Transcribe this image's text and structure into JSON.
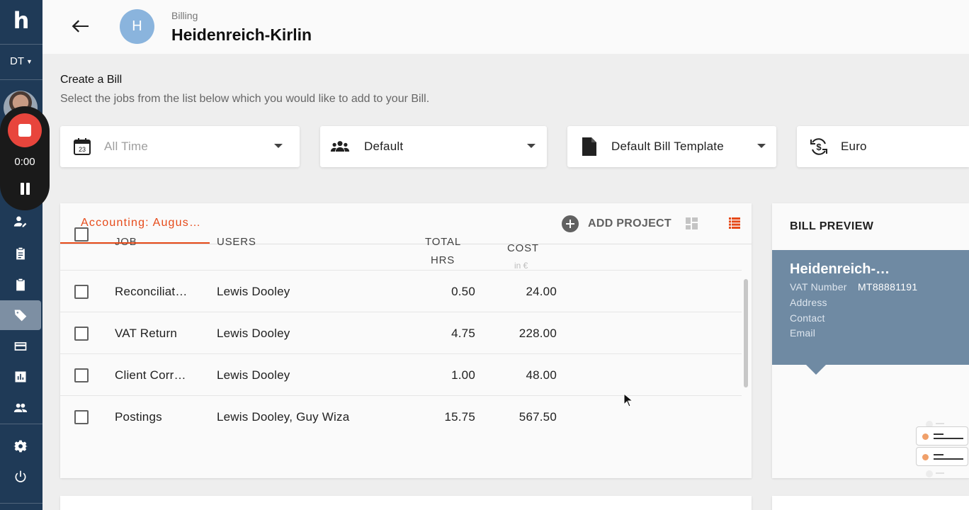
{
  "sidebar": {
    "logo": "h",
    "org": "DT",
    "recorder": {
      "time": "0:00"
    }
  },
  "header": {
    "breadcrumb": "Billing",
    "client_initial": "H",
    "client_name": "Heidenreich-Kirlin"
  },
  "intro": {
    "title": "Create a Bill",
    "subtitle": "Select the jobs from the list below which you would like to add to your Bill."
  },
  "filters": {
    "date": {
      "label": "All Time",
      "icon_text": "23"
    },
    "group": {
      "label": "Default"
    },
    "template": {
      "label": "Default Bill Template"
    },
    "currency": {
      "label": "Euro"
    }
  },
  "jobs": {
    "tab": "Accounting: Augus…",
    "add_project": "ADD PROJECT",
    "columns": {
      "job": "JOB",
      "users": "USERS",
      "total_hrs_1": "TOTAL",
      "total_hrs_2": "HRS",
      "cost": "COST",
      "cost_unit": "in €"
    },
    "rows": [
      {
        "job": "Reconciliat…",
        "users": "Lewis Dooley",
        "hrs": "0.50",
        "cost": "24.00"
      },
      {
        "job": "VAT Return",
        "users": "Lewis Dooley",
        "hrs": "4.75",
        "cost": "228.00"
      },
      {
        "job": "Client Corr…",
        "users": "Lewis Dooley",
        "hrs": "1.00",
        "cost": "48.00"
      },
      {
        "job": "Postings",
        "users": "Lewis Dooley, Guy Wiza",
        "hrs": "15.75",
        "cost": "567.50"
      }
    ]
  },
  "preview": {
    "title": "BILL PREVIEW",
    "client": "Heidenreich-…",
    "vat_label": "VAT Number",
    "vat_value": "MT88881191",
    "address_label": "Address",
    "contact_label": "Contact",
    "email_label": "Email"
  },
  "colors": {
    "accent": "#e64a19",
    "sidebar": "#1f3a57",
    "preview_block": "#6f8aa3",
    "record": "#e8453c"
  }
}
